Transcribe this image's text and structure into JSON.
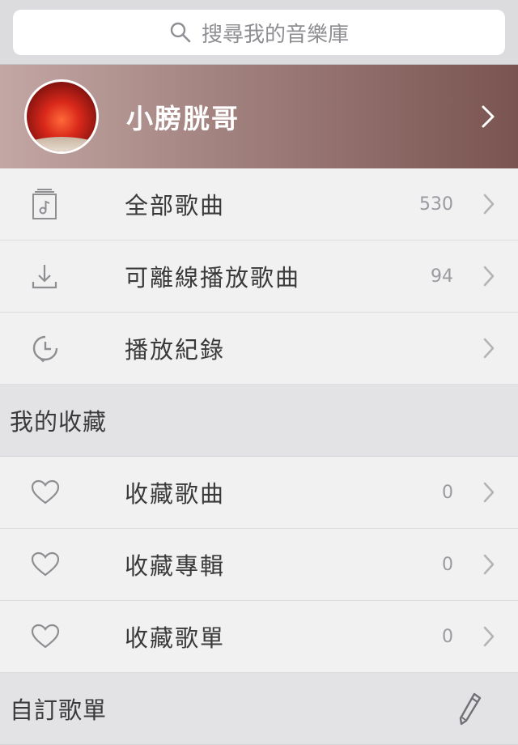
{
  "search": {
    "placeholder": "搜尋我的音樂庫"
  },
  "profile": {
    "name": "小膀胱哥"
  },
  "library": [
    {
      "label": "全部歌曲",
      "count": "530",
      "icon": "music-file-icon"
    },
    {
      "label": "可離線播放歌曲",
      "count": "94",
      "icon": "download-icon"
    },
    {
      "label": "播放紀錄",
      "count": "",
      "icon": "history-clock-icon"
    }
  ],
  "favorites": {
    "title": "我的收藏",
    "items": [
      {
        "label": "收藏歌曲",
        "count": "0",
        "icon": "heart-icon"
      },
      {
        "label": "收藏專輯",
        "count": "0",
        "icon": "heart-icon"
      },
      {
        "label": "收藏歌單",
        "count": "0",
        "icon": "heart-icon"
      }
    ]
  },
  "playlists": {
    "title": "自訂歌單",
    "edit_icon": "pencil-icon"
  },
  "colors": {
    "profile_gradient_end": "#7a5451",
    "text": "#3a3a3a",
    "muted": "#9a9aa0"
  }
}
